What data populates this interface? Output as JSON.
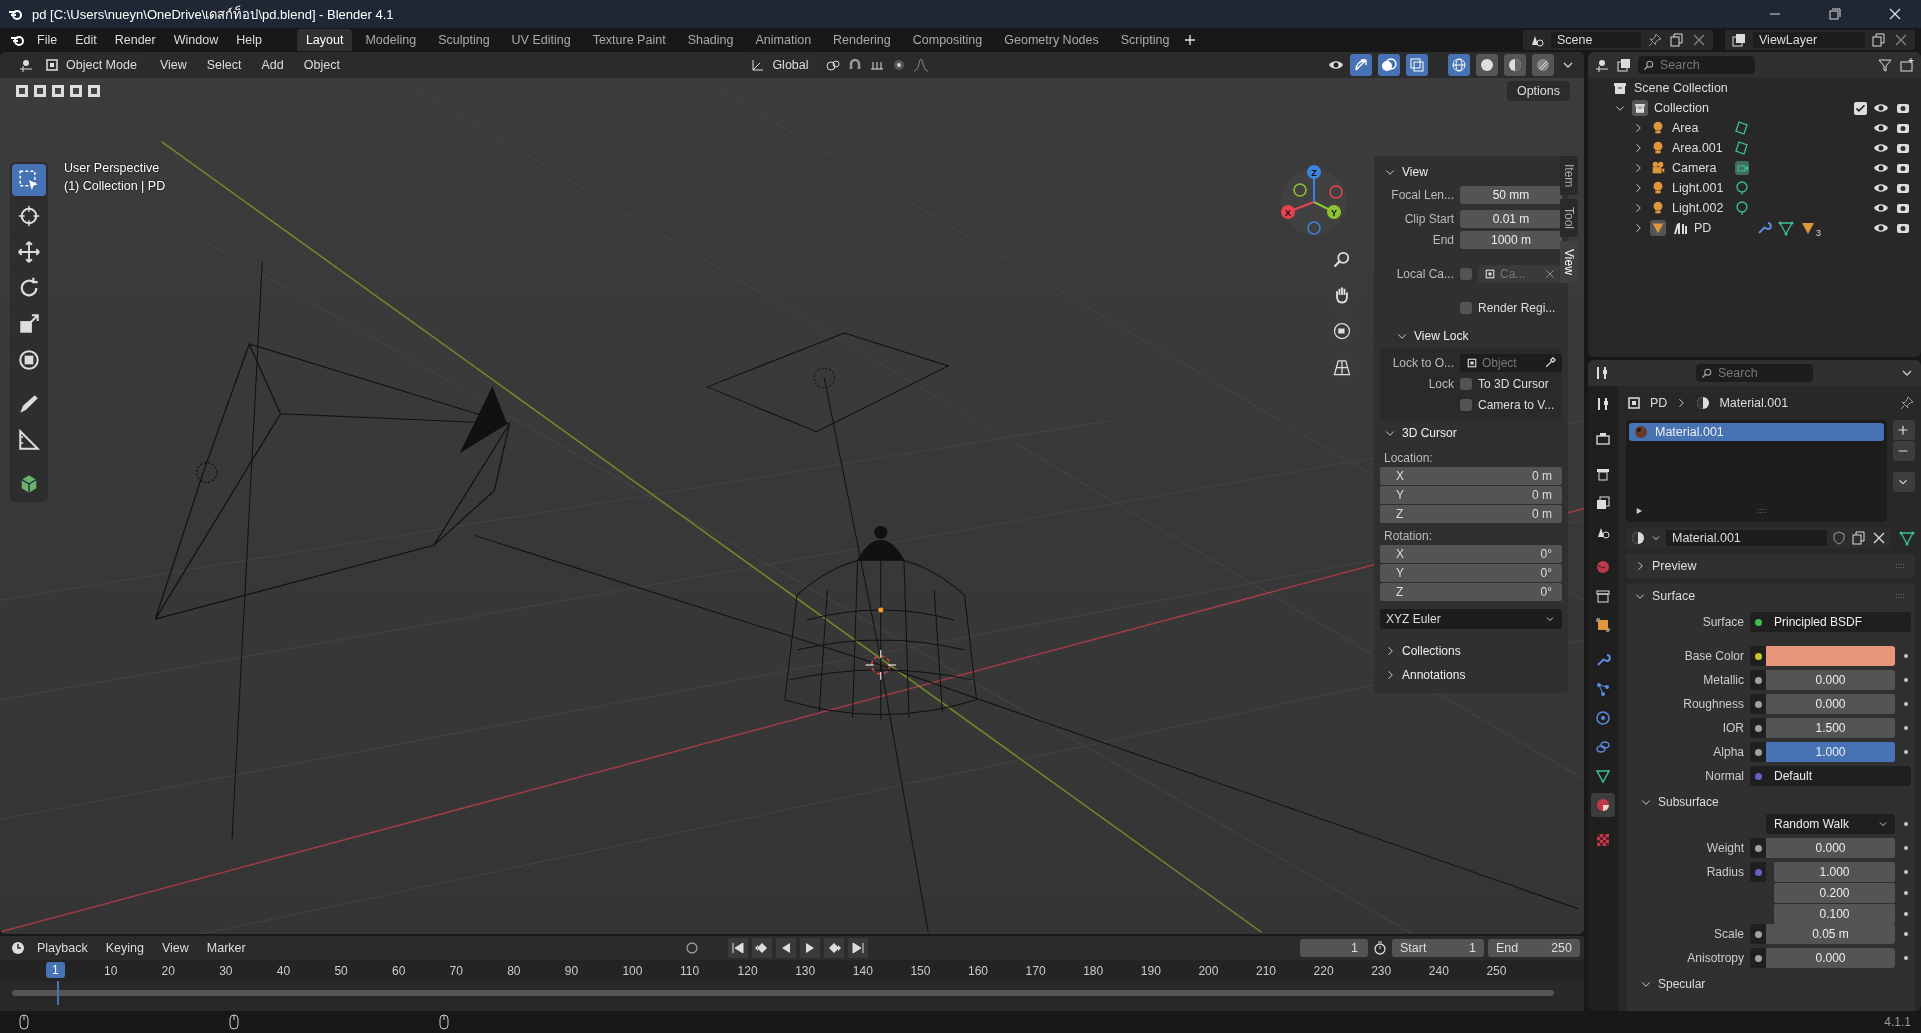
{
  "window": {
    "title": "pd [C:\\Users\\nueyn\\OneDrive\\เดสก์ท็อป\\pd.blend] - Blender 4.1"
  },
  "menu": [
    "File",
    "Edit",
    "Render",
    "Window",
    "Help"
  ],
  "workspaces": [
    {
      "label": "Layout",
      "selected": true
    },
    {
      "label": "Modeling",
      "selected": false
    },
    {
      "label": "Sculpting",
      "selected": false
    },
    {
      "label": "UV Editing",
      "selected": false
    },
    {
      "label": "Texture Paint",
      "selected": false
    },
    {
      "label": "Shading",
      "selected": false
    },
    {
      "label": "Animation",
      "selected": false
    },
    {
      "label": "Rendering",
      "selected": false
    },
    {
      "label": "Compositing",
      "selected": false
    },
    {
      "label": "Geometry Nodes",
      "selected": false
    },
    {
      "label": "Scripting",
      "selected": false
    }
  ],
  "scene": {
    "name": "Scene",
    "view_layer": "ViewLayer"
  },
  "viewport": {
    "mode": "Object Mode",
    "menus": [
      "View",
      "Select",
      "Add",
      "Object"
    ],
    "orientation": "Global",
    "options": "Options",
    "toggles": [
      {
        "kind": "gizmos",
        "on": true
      },
      {
        "kind": "overlays",
        "on": true
      },
      {
        "kind": "xray",
        "on": true
      }
    ],
    "shading": [
      {
        "kind": "wireframe",
        "selected": true
      },
      {
        "kind": "solid",
        "selected": false
      },
      {
        "kind": "material",
        "selected": false
      },
      {
        "kind": "rendered",
        "selected": false
      }
    ],
    "overlay": [
      "User Perspective",
      "(1) Collection | PD"
    ],
    "gizmo": [
      {
        "label": "X",
        "color": "#e8424f"
      },
      {
        "label": "Y",
        "color": "#8cc432"
      },
      {
        "label": "Z",
        "color": "#3b84e0"
      }
    ],
    "tools": [
      {
        "kind": "select",
        "selected": true
      },
      {
        "kind": "cursor",
        "selected": false
      },
      {
        "kind": "move",
        "selected": false
      },
      {
        "kind": "rotate",
        "selected": false
      },
      {
        "kind": "scale",
        "selected": false
      },
      {
        "kind": "transform",
        "selected": false
      },
      {
        "kind": "annotate",
        "selected": false
      },
      {
        "kind": "measure",
        "selected": false
      },
      {
        "kind": "add_cube",
        "selected": false
      }
    ]
  },
  "sidebar": {
    "tabs": [
      {
        "label": "Item",
        "selected": false
      },
      {
        "label": "Tool",
        "selected": false
      },
      {
        "label": "View",
        "selected": true
      }
    ],
    "view": {
      "title": "View",
      "expanded": true,
      "fields": [
        {
          "label": "Focal Len...",
          "value": "50 mm"
        },
        {
          "label": "Clip Start",
          "value": "0.01 m"
        },
        {
          "label": "End",
          "value": "1000 m"
        }
      ],
      "local_camera": {
        "label": "Local Ca...",
        "checked": false,
        "placeholder": "Ca..."
      },
      "render_region": {
        "label": "Render Regi...",
        "checked": false
      }
    },
    "view_lock": {
      "title": "View Lock",
      "expanded": true,
      "lock_to": {
        "label": "Lock to O...",
        "placeholder": "Object"
      },
      "lock_label": "Lock",
      "checks": [
        {
          "label": "To 3D Cursor",
          "checked": false
        },
        {
          "label": "Camera to V...",
          "checked": false
        }
      ]
    },
    "cursor": {
      "title": "3D Cursor",
      "expanded": true,
      "location_label": "Location:",
      "location": [
        {
          "axis": "X",
          "value": "0 m"
        },
        {
          "axis": "Y",
          "value": "0 m"
        },
        {
          "axis": "Z",
          "value": "0 m"
        }
      ],
      "rotation_label": "Rotation:",
      "rotation": [
        {
          "axis": "X",
          "value": "0°"
        },
        {
          "axis": "Y",
          "value": "0°"
        },
        {
          "axis": "Z",
          "value": "0°"
        }
      ],
      "rotation_mode": "XYZ Euler"
    },
    "more": [
      {
        "title": "Collections",
        "expanded": false
      },
      {
        "title": "Annotations",
        "expanded": false
      }
    ]
  },
  "outliner": {
    "search": {
      "placeholder": "Search"
    },
    "root": "Scene Collection",
    "collection": {
      "label": "Collection",
      "expanded": true,
      "checked": true,
      "visible": true,
      "children": [
        {
          "label": "Area",
          "kind": "area_light",
          "expanded": false,
          "visible": true
        },
        {
          "label": "Area.001",
          "kind": "area_light",
          "expanded": false,
          "visible": true
        },
        {
          "label": "Camera",
          "kind": "camera",
          "expanded": false,
          "visible": true
        },
        {
          "label": "Light.001",
          "kind": "point_light",
          "expanded": false,
          "visible": true
        },
        {
          "label": "Light.002",
          "kind": "point_light",
          "expanded": false,
          "visible": true
        },
        {
          "label": "PD",
          "kind": "mesh",
          "expanded": false,
          "visible": true,
          "badge": "3"
        }
      ]
    }
  },
  "properties": {
    "search": {
      "placeholder": "Search"
    },
    "tabs": [
      {
        "kind": "tool",
        "selected": false
      },
      {
        "kind": "render",
        "selected": false
      },
      {
        "kind": "output",
        "selected": false
      },
      {
        "kind": "view_layer",
        "selected": false
      },
      {
        "kind": "scene",
        "selected": false
      },
      {
        "kind": "world",
        "selected": false
      },
      {
        "kind": "collection",
        "selected": false
      },
      {
        "kind": "object",
        "selected": false
      },
      {
        "kind": "modifiers",
        "selected": false
      },
      {
        "kind": "particles",
        "selected": false
      },
      {
        "kind": "physics",
        "selected": false
      },
      {
        "kind": "constraints",
        "selected": false
      },
      {
        "kind": "data",
        "selected": false
      },
      {
        "kind": "material",
        "selected": true
      },
      {
        "kind": "texture",
        "selected": false
      }
    ],
    "breadcrumb": [
      "PD",
      "Material.001"
    ],
    "slots": [
      {
        "label": "Material.001",
        "selected": true
      }
    ],
    "material": "Material.001",
    "panels": [
      {
        "title": "Preview",
        "expanded": false
      },
      {
        "title": "Surface",
        "expanded": true
      }
    ],
    "rows": [
      {
        "kind": "link",
        "label": "Surface",
        "value": "Principled BSDF",
        "socket": {
          "color": "#3fbf4f"
        }
      },
      {
        "kind": "color",
        "label": "Base Color",
        "swatch": {
          "color": "#e8967a"
        },
        "socket": {
          "color": "#c7c729"
        }
      },
      {
        "kind": "slider",
        "label": "Metallic",
        "value": "0.000",
        "level": 0,
        "socket": {
          "color": "#a1a1a1"
        }
      },
      {
        "kind": "slider",
        "label": "Roughness",
        "value": "0.000",
        "level": 0,
        "socket": {
          "color": "#a1a1a1"
        }
      },
      {
        "kind": "number",
        "label": "IOR",
        "value": "1.500",
        "socket": {
          "color": "#a1a1a1"
        }
      },
      {
        "kind": "slider",
        "label": "Alpha",
        "value": "1.000",
        "level": 1,
        "socket": {
          "color": "#a1a1a1"
        }
      },
      {
        "kind": "link",
        "label": "Normal",
        "value": "Default",
        "socket": {
          "color": "#6363c7"
        }
      },
      {
        "kind": "group",
        "label": "Subsurface",
        "expanded": true
      },
      {
        "kind": "dropdown",
        "value": "Random Walk"
      },
      {
        "kind": "slider",
        "label": "Weight",
        "value": "0.000",
        "level": 0,
        "socket": {
          "color": "#a1a1a1"
        }
      },
      {
        "kind": "vector",
        "label": "Radius",
        "values": [
          "1.000",
          "0.200",
          "0.100"
        ],
        "socket": {
          "color": "#6363c7"
        }
      },
      {
        "kind": "number",
        "label": "Scale",
        "value": "0.05 m",
        "socket": {
          "color": "#a1a1a1"
        }
      },
      {
        "kind": "slider",
        "label": "Anisotropy",
        "value": "0.000",
        "level": 0,
        "socket": {
          "color": "#a1a1a1"
        }
      },
      {
        "kind": "group",
        "label": "Specular",
        "expanded": true
      }
    ]
  },
  "timeline": {
    "menus": [
      "Playback",
      "Keying",
      "View",
      "Marker"
    ],
    "frame": "1",
    "start": {
      "label": "Start",
      "value": "1"
    },
    "end": {
      "label": "End",
      "value": "250"
    },
    "ruler": [
      "1",
      "10",
      "20",
      "30",
      "40",
      "50",
      "60",
      "70",
      "80",
      "90",
      "100",
      "110",
      "120",
      "130",
      "140",
      "150",
      "160",
      "170",
      "180",
      "190",
      "200",
      "210",
      "220",
      "230",
      "240",
      "250"
    ]
  },
  "status": {
    "version": "4.1.1"
  }
}
